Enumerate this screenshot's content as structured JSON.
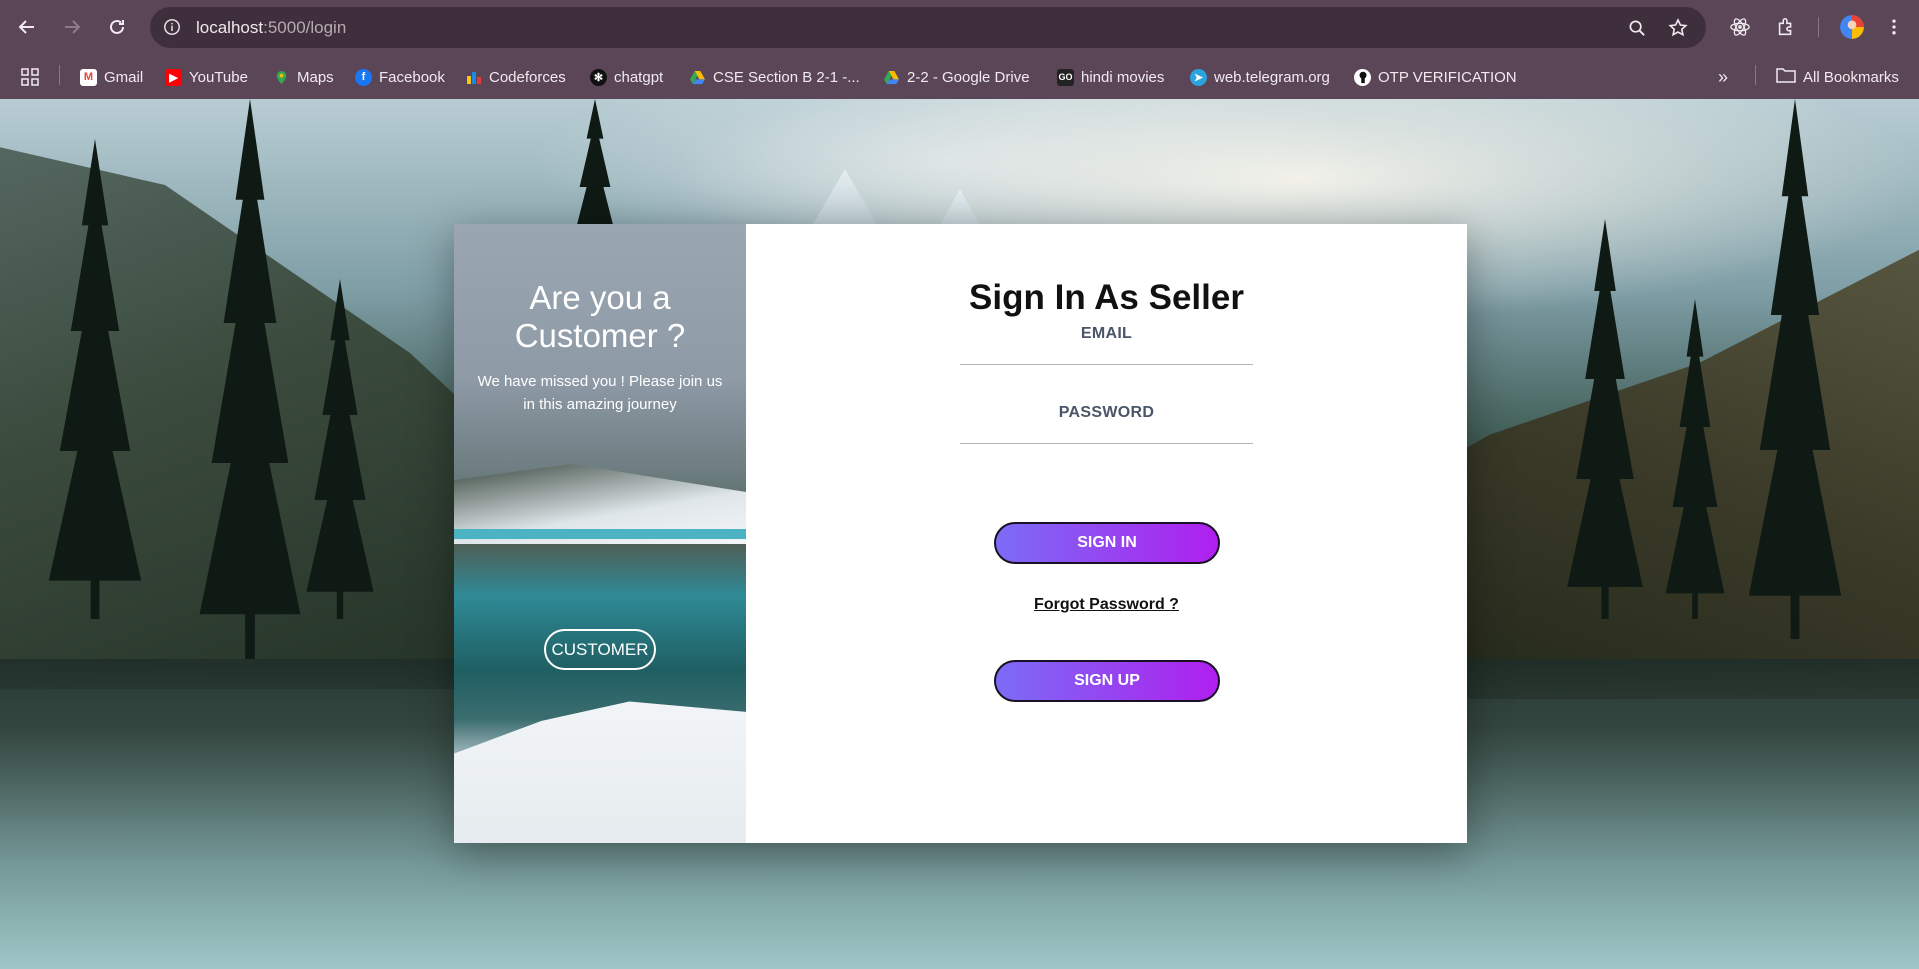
{
  "browser": {
    "url_host": "localhost",
    "url_path": ":5000/login",
    "icons": [
      "back-icon",
      "forward-icon",
      "reload-icon",
      "site-info-icon",
      "zoom-icon",
      "star-icon",
      "react-devtools-icon",
      "extensions-icon",
      "profile-avatar-icon",
      "menu-icon"
    ]
  },
  "bookmarks": {
    "items": [
      {
        "label": "Gmail",
        "icon": "gmail-icon",
        "color": "#ea4335"
      },
      {
        "label": "YouTube",
        "icon": "youtube-icon",
        "color": "#ff0000"
      },
      {
        "label": "Maps",
        "icon": "maps-icon",
        "color": "#34a853"
      },
      {
        "label": "Facebook",
        "icon": "facebook-icon",
        "color": "#1877f2"
      },
      {
        "label": "Codeforces",
        "icon": "codeforces-icon",
        "color": "#f5c518"
      },
      {
        "label": "chatgpt",
        "icon": "chatgpt-icon",
        "color": "#111111"
      },
      {
        "label": "CSE Section B 2-1 -...",
        "icon": "google-drive-icon",
        "color": "#fbbc04"
      },
      {
        "label": "2-2 - Google Drive",
        "icon": "google-drive-icon",
        "color": "#fbbc04"
      },
      {
        "label": "hindi movies",
        "icon": "go-movies-icon",
        "color": "#222222"
      },
      {
        "label": "web.telegram.org",
        "icon": "telegram-icon",
        "color": "#2aa3df"
      },
      {
        "label": "OTP VERIFICATION",
        "icon": "github-icon",
        "color": "#ffffff"
      }
    ],
    "more": "»",
    "all_bookmarks": "All Bookmarks"
  },
  "customer_panel": {
    "title": "Are you a Customer ?",
    "text": "We have missed you ! Please join us in this amazing journey",
    "button": "CUSTOMER"
  },
  "seller_form": {
    "title": "Sign In As Seller",
    "email_label": "EMAIL",
    "password_label": "PASSWORD",
    "sign_in": "SIGN IN",
    "forgot": "Forgot Password ?",
    "sign_up": "SIGN UP",
    "button_gradient": [
      "#7b6cf6",
      "#b01ff0"
    ]
  }
}
